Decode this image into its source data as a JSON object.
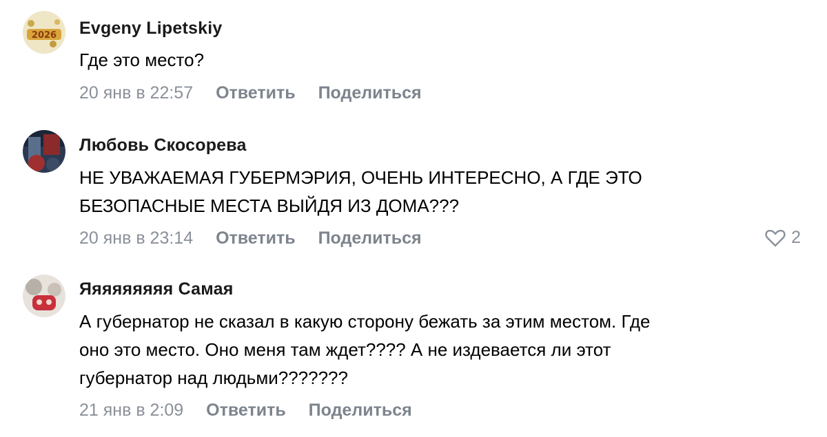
{
  "comments": [
    {
      "author": "Evgeny Lipetskiy",
      "lines": [
        "Где это место?"
      ],
      "date": "20 янв в 22:57",
      "reply_label": "Ответить",
      "share_label": "Поделиться"
    },
    {
      "author": "Любовь Скосорева",
      "lines": [
        "НЕ УВАЖАЕМАЯ ГУБЕРМЭРИЯ, ОЧЕНЬ ИНТЕРЕСНО, А ГДЕ ЭТО",
        "БЕЗОПАСНЫЕ МЕСТА ВЫЙДЯ ИЗ ДОМА???"
      ],
      "date": "20 янв в 23:14",
      "reply_label": "Ответить",
      "share_label": "Поделиться",
      "likes": "2",
      "like_icon": "heart-outline-icon"
    },
    {
      "author": "Яяяяяяяяя Самая",
      "lines": [
        "А губернатор не сказал в какую сторону бежать за этим местом. Где",
        "оно это место. Оно меня там ждет???? А не издевается ли этот",
        "губернатор над людьми???????"
      ],
      "date": "21 янв в 2:09",
      "reply_label": "Ответить",
      "share_label": "Поделиться"
    }
  ],
  "avatar_badge": "2026",
  "colors": {
    "meta": "#8a9099",
    "action": "#7d848d",
    "author": "#1a1a1a",
    "text": "#000000"
  }
}
